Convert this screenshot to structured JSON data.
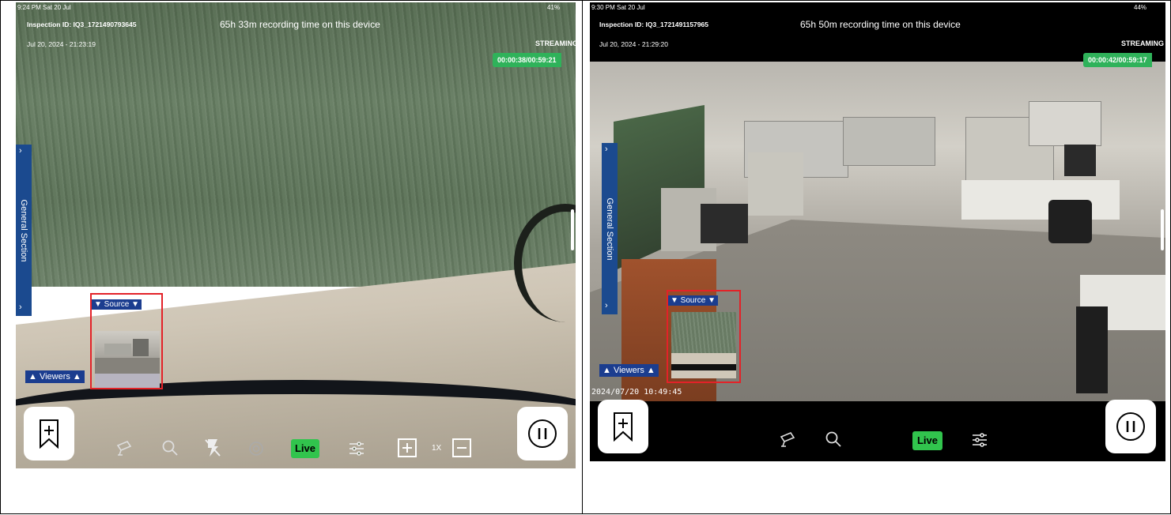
{
  "left": {
    "status_time": "9:24 PM  Sat 20 Jul",
    "status_battery": "41%",
    "inspection_id": "Inspection ID: IQ3_1721490793645",
    "datetime": "Jul 20, 2024 - 21:23:19",
    "recording_time": "65h 33m recording time on this device",
    "streaming": "STREAMING",
    "timer": "00:00:38/00:59:21",
    "side_tab_label": "General Section",
    "source_label": "▼ Source ▼",
    "viewers_label": "▲ Viewers ▲",
    "live_label": "Live",
    "zoom_label": "1X"
  },
  "right": {
    "status_time": "9:30 PM  Sat 20 Jul",
    "status_battery": "44%",
    "inspection_id": "Inspection ID: IQ3_1721491157965",
    "datetime": "Jul 20, 2024 - 21:29:20",
    "recording_time": "65h 50m recording time on this device",
    "streaming": "STREAMING",
    "timer": "00:00:42/00:59:17",
    "side_tab_label": "General Section",
    "source_label": "▼ Source ▼",
    "viewers_label": "▲ Viewers ▲",
    "camera_date_stamp": "2024/07/20 10:49:45",
    "live_label": "Live"
  },
  "colors": {
    "timer_green": "#2fb25a",
    "live_green": "#31c44d",
    "side_tab_blue": "#1b4a8f",
    "pip_border_red": "#e32228"
  },
  "icons": [
    "bookmark-add-icon",
    "camera-icon",
    "search-icon",
    "flash-off-icon",
    "capture-icon",
    "settings-sliders-icon",
    "zoom-in-icon",
    "zoom-out-icon",
    "pause-icon",
    "chevron-right-icon"
  ]
}
